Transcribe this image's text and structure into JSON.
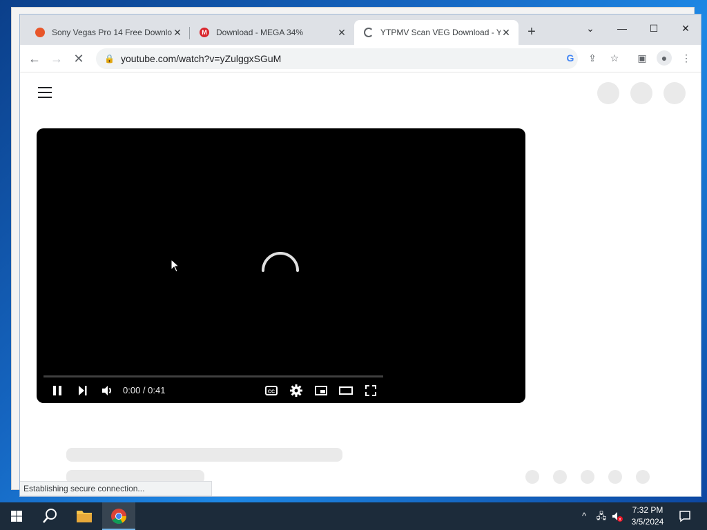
{
  "browser": {
    "tabs": [
      {
        "title": "Sony Vegas Pro 14 Free Downlo",
        "favicon": "download-favicon-icon",
        "color": "#e8562a"
      },
      {
        "title": "Download - MEGA 34%",
        "favicon": "mega-favicon-icon",
        "color": "#d9272e"
      },
      {
        "title": "YTPMV Scan VEG Download - Yo",
        "favicon": "loading-favicon-icon",
        "color": "#5f6368"
      }
    ],
    "active_tab_index": 2,
    "url": "youtube.com/watch?v=yZulggxSGuM"
  },
  "player": {
    "time": "0:00 / 0:41",
    "progress": 0.0
  },
  "status": {
    "text": "Establishing secure connection..."
  },
  "taskbar": {
    "time": "7:32 PM",
    "date": "3/5/2024"
  },
  "colors": {
    "accent": "#1a73e8",
    "youtube_red": "#ff0000",
    "taskbar_bg": "#1c2b3a"
  }
}
